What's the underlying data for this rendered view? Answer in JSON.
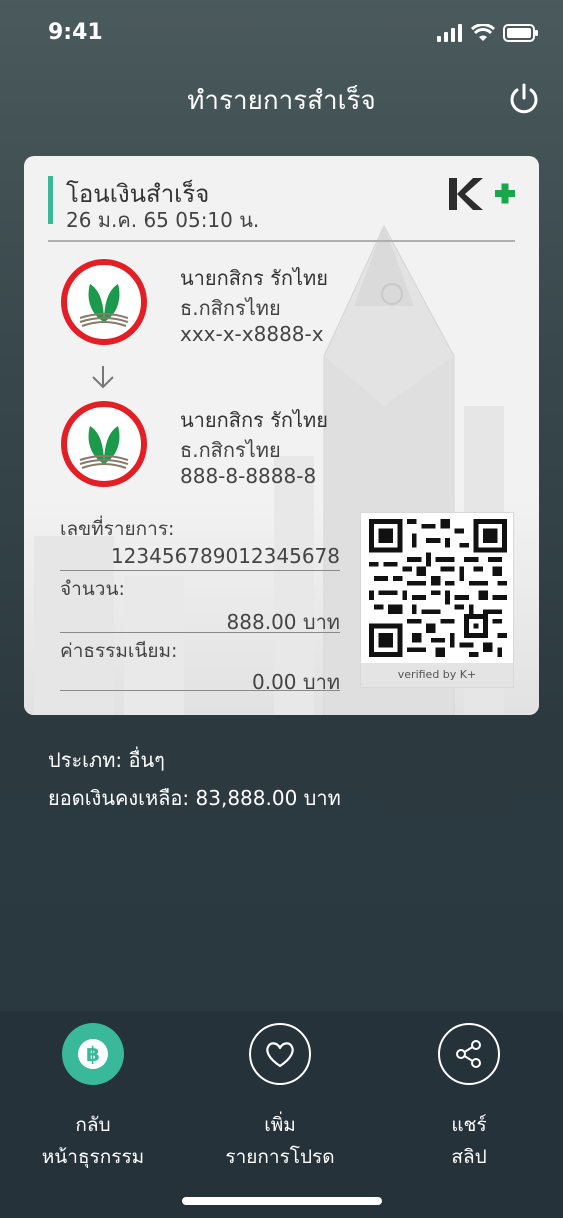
{
  "status_bar": {
    "time": "9:41"
  },
  "header": {
    "title": "ทำรายการสำเร็จ",
    "power_icon": "power-icon"
  },
  "slip": {
    "title": "โอนเงินสำเร็จ",
    "datetime": "26 ม.ค. 65  05:10 น.",
    "brand_logo_text": "K+",
    "from": {
      "name": "นายกสิกร รักไทย",
      "bank": "ธ.กสิกรไทย",
      "account": "xxx-x-x8888-x"
    },
    "to": {
      "name": "นายกสิกร รักไทย",
      "bank": "ธ.กสิกรไทย",
      "account": "888-8-8888-8"
    },
    "fields": [
      {
        "label": "เลขที่รายการ:",
        "value": "12345678901234567​8"
      },
      {
        "label": "จำนวน:",
        "value": "888.00 บาท"
      },
      {
        "label": "ค่าธรรมเนียม:",
        "value": "0.00 บาท"
      }
    ],
    "qr_caption": "verified by K+"
  },
  "info": {
    "type_line": "ประเภท: อื่นๆ",
    "balance_line": "ยอดเงินคงเหลือ: 83,888.00 บาท"
  },
  "actions": [
    {
      "line1": "กลับ",
      "line2": "หน้าธุรกรรม",
      "icon": "baht-icon"
    },
    {
      "line1": "เพิ่ม",
      "line2": "รายการโปรด",
      "icon": "heart-icon"
    },
    {
      "line1": "แชร์",
      "line2": "สลิป",
      "icon": "share-icon"
    }
  ],
  "colors": {
    "accent": "#39b89a",
    "kbank_green": "#1a9a4a",
    "kbank_red": "#e31e24"
  }
}
